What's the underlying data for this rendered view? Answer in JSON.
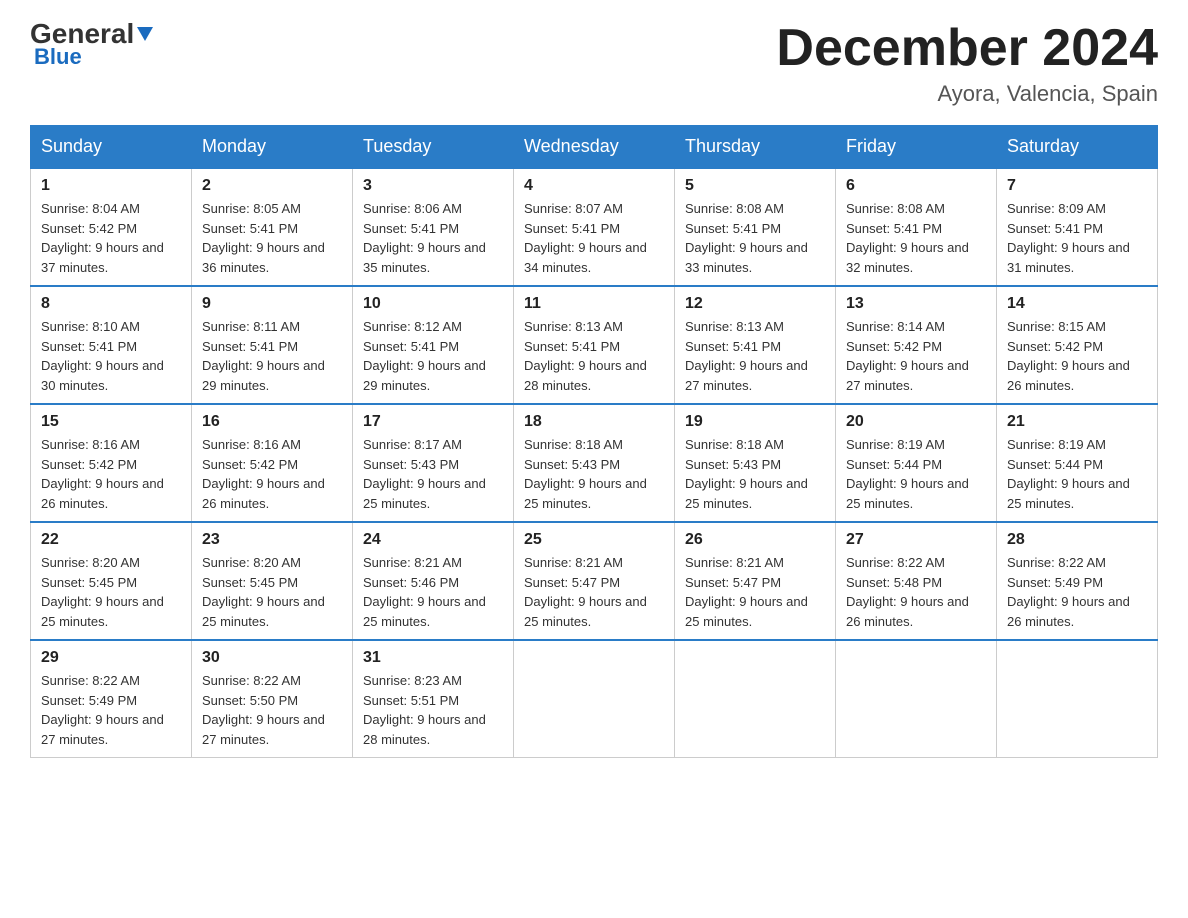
{
  "header": {
    "logo_line1": "General",
    "logo_line2": "Blue",
    "month": "December 2024",
    "location": "Ayora, Valencia, Spain"
  },
  "days_of_week": [
    "Sunday",
    "Monday",
    "Tuesday",
    "Wednesday",
    "Thursday",
    "Friday",
    "Saturday"
  ],
  "weeks": [
    [
      {
        "day": "1",
        "sunrise": "8:04 AM",
        "sunset": "5:42 PM",
        "daylight": "9 hours and 37 minutes."
      },
      {
        "day": "2",
        "sunrise": "8:05 AM",
        "sunset": "5:41 PM",
        "daylight": "9 hours and 36 minutes."
      },
      {
        "day": "3",
        "sunrise": "8:06 AM",
        "sunset": "5:41 PM",
        "daylight": "9 hours and 35 minutes."
      },
      {
        "day": "4",
        "sunrise": "8:07 AM",
        "sunset": "5:41 PM",
        "daylight": "9 hours and 34 minutes."
      },
      {
        "day": "5",
        "sunrise": "8:08 AM",
        "sunset": "5:41 PM",
        "daylight": "9 hours and 33 minutes."
      },
      {
        "day": "6",
        "sunrise": "8:08 AM",
        "sunset": "5:41 PM",
        "daylight": "9 hours and 32 minutes."
      },
      {
        "day": "7",
        "sunrise": "8:09 AM",
        "sunset": "5:41 PM",
        "daylight": "9 hours and 31 minutes."
      }
    ],
    [
      {
        "day": "8",
        "sunrise": "8:10 AM",
        "sunset": "5:41 PM",
        "daylight": "9 hours and 30 minutes."
      },
      {
        "day": "9",
        "sunrise": "8:11 AM",
        "sunset": "5:41 PM",
        "daylight": "9 hours and 29 minutes."
      },
      {
        "day": "10",
        "sunrise": "8:12 AM",
        "sunset": "5:41 PM",
        "daylight": "9 hours and 29 minutes."
      },
      {
        "day": "11",
        "sunrise": "8:13 AM",
        "sunset": "5:41 PM",
        "daylight": "9 hours and 28 minutes."
      },
      {
        "day": "12",
        "sunrise": "8:13 AM",
        "sunset": "5:41 PM",
        "daylight": "9 hours and 27 minutes."
      },
      {
        "day": "13",
        "sunrise": "8:14 AM",
        "sunset": "5:42 PM",
        "daylight": "9 hours and 27 minutes."
      },
      {
        "day": "14",
        "sunrise": "8:15 AM",
        "sunset": "5:42 PM",
        "daylight": "9 hours and 26 minutes."
      }
    ],
    [
      {
        "day": "15",
        "sunrise": "8:16 AM",
        "sunset": "5:42 PM",
        "daylight": "9 hours and 26 minutes."
      },
      {
        "day": "16",
        "sunrise": "8:16 AM",
        "sunset": "5:42 PM",
        "daylight": "9 hours and 26 minutes."
      },
      {
        "day": "17",
        "sunrise": "8:17 AM",
        "sunset": "5:43 PM",
        "daylight": "9 hours and 25 minutes."
      },
      {
        "day": "18",
        "sunrise": "8:18 AM",
        "sunset": "5:43 PM",
        "daylight": "9 hours and 25 minutes."
      },
      {
        "day": "19",
        "sunrise": "8:18 AM",
        "sunset": "5:43 PM",
        "daylight": "9 hours and 25 minutes."
      },
      {
        "day": "20",
        "sunrise": "8:19 AM",
        "sunset": "5:44 PM",
        "daylight": "9 hours and 25 minutes."
      },
      {
        "day": "21",
        "sunrise": "8:19 AM",
        "sunset": "5:44 PM",
        "daylight": "9 hours and 25 minutes."
      }
    ],
    [
      {
        "day": "22",
        "sunrise": "8:20 AM",
        "sunset": "5:45 PM",
        "daylight": "9 hours and 25 minutes."
      },
      {
        "day": "23",
        "sunrise": "8:20 AM",
        "sunset": "5:45 PM",
        "daylight": "9 hours and 25 minutes."
      },
      {
        "day": "24",
        "sunrise": "8:21 AM",
        "sunset": "5:46 PM",
        "daylight": "9 hours and 25 minutes."
      },
      {
        "day": "25",
        "sunrise": "8:21 AM",
        "sunset": "5:47 PM",
        "daylight": "9 hours and 25 minutes."
      },
      {
        "day": "26",
        "sunrise": "8:21 AM",
        "sunset": "5:47 PM",
        "daylight": "9 hours and 25 minutes."
      },
      {
        "day": "27",
        "sunrise": "8:22 AM",
        "sunset": "5:48 PM",
        "daylight": "9 hours and 26 minutes."
      },
      {
        "day": "28",
        "sunrise": "8:22 AM",
        "sunset": "5:49 PM",
        "daylight": "9 hours and 26 minutes."
      }
    ],
    [
      {
        "day": "29",
        "sunrise": "8:22 AM",
        "sunset": "5:49 PM",
        "daylight": "9 hours and 27 minutes."
      },
      {
        "day": "30",
        "sunrise": "8:22 AM",
        "sunset": "5:50 PM",
        "daylight": "9 hours and 27 minutes."
      },
      {
        "day": "31",
        "sunrise": "8:23 AM",
        "sunset": "5:51 PM",
        "daylight": "9 hours and 28 minutes."
      },
      null,
      null,
      null,
      null
    ]
  ],
  "labels": {
    "sunrise_prefix": "Sunrise: ",
    "sunset_prefix": "Sunset: ",
    "daylight_prefix": "Daylight: "
  }
}
